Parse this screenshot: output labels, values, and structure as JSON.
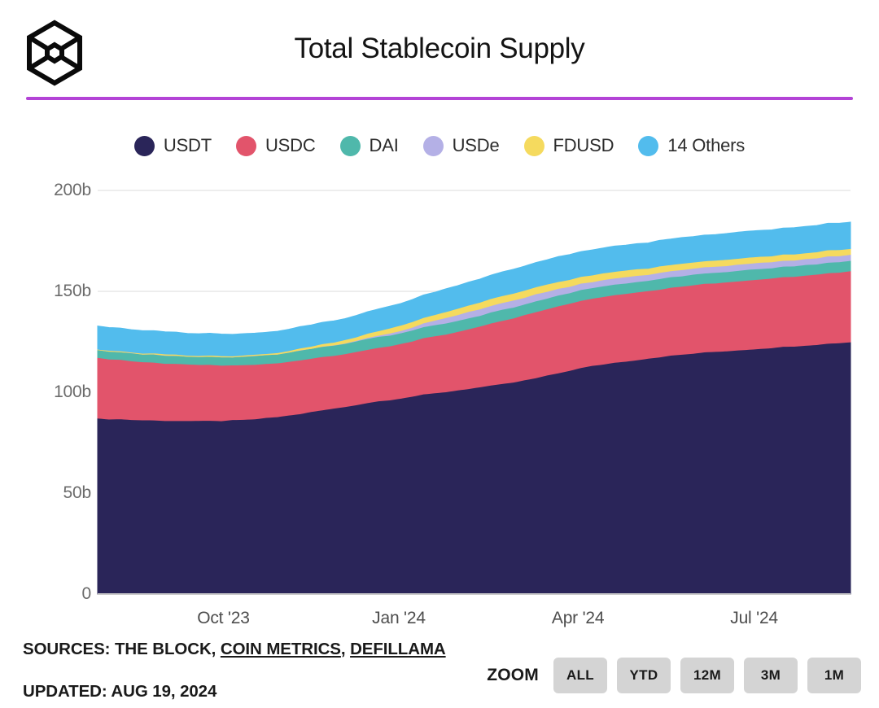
{
  "header": {
    "title": "Total Stablecoin Supply",
    "logo_icon": "the-block-hexagon-logo",
    "accent_color": "#b343d6"
  },
  "footer": {
    "sources_prefix": "SOURCES: THE BLOCK, ",
    "source_link_1": "COIN METRICS",
    "sources_comma": ",",
    "source_link_2": "DEFILLAMA",
    "updated": "UPDATED: AUG 19, 2024",
    "zoom_label": "ZOOM",
    "zoom_options": [
      "ALL",
      "YTD",
      "12M",
      "3M",
      "1M"
    ]
  },
  "chart_data": {
    "type": "area",
    "stacked": true,
    "title": "Total Stablecoin Supply",
    "xlabel": "",
    "ylabel": "",
    "grid": true,
    "grid_lines_at": [
      150,
      200
    ],
    "legend_position": "top-center",
    "ylim": [
      0,
      200
    ],
    "y_ticks": [
      0,
      50,
      100,
      150,
      200
    ],
    "y_tick_labels": [
      "0",
      "50b",
      "100b",
      "150b",
      "200b"
    ],
    "y_unit": "billions USD",
    "x_ticks": [
      "Oct '23",
      "Jan '24",
      "Apr '24",
      "Jul '24"
    ],
    "x_tick_positions": [
      0.167,
      0.4,
      0.638,
      0.872
    ],
    "x_range": [
      "Aug '23",
      "Aug 19 2024"
    ],
    "colors": {
      "USDT": "#2a2559",
      "USDC": "#e2546b",
      "DAI": "#4fb8ab",
      "USDe": "#b4b0e6",
      "FDUSD": "#f5da5e",
      "14 Others": "#52bced"
    },
    "series": [
      {
        "name": "USDT",
        "color": "#2a2559",
        "values": [
          87.0,
          86.9,
          86.8,
          86.5,
          86.3,
          86.2,
          86.1,
          86.0,
          85.9,
          85.8,
          85.9,
          86.0,
          86.2,
          86.4,
          86.8,
          87.3,
          87.9,
          88.6,
          89.4,
          90.3,
          91.2,
          92.0,
          92.9,
          93.9,
          94.9,
          95.7,
          96.4,
          97.2,
          98.0,
          98.9,
          99.6,
          100.3,
          101.1,
          101.9,
          102.6,
          103.3,
          104.1,
          105.0,
          106.0,
          107.1,
          108.3,
          109.6,
          110.9,
          112.1,
          113.1,
          114.0,
          114.8,
          115.5,
          116.2,
          116.9,
          117.6,
          118.2,
          118.8,
          119.3,
          119.8,
          120.2,
          120.6,
          121.0,
          121.4,
          121.8,
          122.2,
          122.6,
          123.0,
          123.4,
          123.8,
          124.2,
          124.6,
          125.0
        ]
      },
      {
        "name": "USDC",
        "color": "#e2546b",
        "values": [
          30.0,
          29.7,
          29.4,
          29.1,
          28.8,
          28.6,
          28.4,
          28.2,
          28.0,
          27.8,
          27.6,
          27.4,
          27.2,
          27.0,
          26.9,
          26.8,
          26.7,
          26.6,
          26.5,
          26.4,
          26.3,
          26.2,
          26.2,
          26.3,
          26.4,
          26.6,
          26.8,
          27.1,
          27.4,
          27.8,
          28.2,
          28.6,
          29.0,
          29.5,
          30.0,
          30.6,
          31.2,
          31.8,
          32.2,
          32.6,
          32.9,
          33.1,
          33.2,
          33.3,
          33.4,
          33.5,
          33.6,
          33.6,
          33.6,
          33.6,
          33.6,
          33.6,
          33.7,
          33.8,
          33.9,
          34.0,
          34.1,
          34.2,
          34.3,
          34.4,
          34.5,
          34.6,
          34.7,
          34.8,
          34.9,
          35.0,
          35.1,
          35.2
        ]
      },
      {
        "name": "DAI",
        "color": "#4fb8ab",
        "values": [
          3.9,
          3.9,
          3.9,
          3.9,
          3.9,
          3.9,
          3.9,
          3.9,
          4.0,
          4.0,
          4.0,
          4.1,
          4.2,
          4.3,
          4.4,
          4.5,
          4.6,
          4.7,
          4.8,
          4.9,
          5.0,
          5.1,
          5.2,
          5.3,
          5.3,
          5.4,
          5.4,
          5.4,
          5.4,
          5.4,
          5.4,
          5.4,
          5.4,
          5.4,
          5.4,
          5.4,
          5.4,
          5.3,
          5.3,
          5.3,
          5.3,
          5.3,
          5.3,
          5.3,
          5.3,
          5.3,
          5.3,
          5.2,
          5.2,
          5.2,
          5.2,
          5.2,
          5.2,
          5.2,
          5.2,
          5.2,
          5.2,
          5.2,
          5.2,
          5.2,
          5.2,
          5.2,
          5.2,
          5.2,
          5.2,
          5.2,
          5.2,
          5.2
        ]
      },
      {
        "name": "USDe",
        "color": "#b4b0e6",
        "values": [
          0.0,
          0.0,
          0.0,
          0.0,
          0.0,
          0.0,
          0.0,
          0.0,
          0.0,
          0.0,
          0.0,
          0.0,
          0.0,
          0.0,
          0.0,
          0.0,
          0.0,
          0.0,
          0.0,
          0.0,
          0.1,
          0.2,
          0.3,
          0.4,
          0.5,
          0.7,
          0.9,
          1.2,
          1.5,
          1.9,
          2.3,
          2.6,
          2.9,
          3.1,
          3.2,
          3.3,
          3.3,
          3.4,
          3.4,
          3.4,
          3.3,
          3.3,
          3.2,
          3.2,
          3.1,
          3.1,
          3.0,
          3.0,
          3.0,
          3.0,
          3.0,
          3.0,
          3.0,
          3.0,
          3.0,
          3.0,
          3.0,
          3.0,
          3.0,
          3.0,
          3.0,
          3.0,
          3.0,
          3.0,
          3.0,
          3.0,
          3.0,
          3.0
        ]
      },
      {
        "name": "FDUSD",
        "color": "#f5da5e",
        "values": [
          0.4,
          0.4,
          0.4,
          0.4,
          0.4,
          0.5,
          0.5,
          0.5,
          0.5,
          0.5,
          0.5,
          0.5,
          0.6,
          0.6,
          0.6,
          0.6,
          0.7,
          0.8,
          0.9,
          1.0,
          1.2,
          1.4,
          1.6,
          1.8,
          2.0,
          2.2,
          2.4,
          2.6,
          2.7,
          2.8,
          2.9,
          3.0,
          3.1,
          3.2,
          3.3,
          3.4,
          3.4,
          3.5,
          3.5,
          3.5,
          3.5,
          3.4,
          3.4,
          3.4,
          3.3,
          3.3,
          3.3,
          3.2,
          3.2,
          3.2,
          3.1,
          3.1,
          3.1,
          3.1,
          3.0,
          3.0,
          3.0,
          3.0,
          3.0,
          3.0,
          3.0,
          3.0,
          3.0,
          3.0,
          3.0,
          3.0,
          3.0,
          3.0
        ]
      },
      {
        "name": "14 Others",
        "color": "#52bced",
        "values": [
          11.5,
          11.4,
          11.3,
          11.2,
          11.1,
          11.0,
          11.0,
          10.9,
          10.9,
          10.8,
          10.8,
          10.7,
          10.7,
          10.6,
          10.6,
          10.6,
          10.5,
          10.5,
          10.5,
          10.5,
          10.5,
          10.5,
          10.5,
          10.6,
          10.6,
          10.7,
          10.8,
          10.9,
          11.0,
          11.1,
          11.2,
          11.3,
          11.4,
          11.5,
          11.6,
          11.7,
          11.8,
          11.9,
          12.0,
          12.1,
          12.2,
          12.3,
          12.3,
          12.4,
          12.4,
          12.5,
          12.5,
          12.5,
          12.6,
          12.6,
          12.6,
          12.7,
          12.7,
          12.7,
          12.8,
          12.8,
          12.8,
          12.9,
          12.9,
          12.9,
          13.0,
          13.0,
          13.0,
          13.1,
          13.1,
          13.1,
          13.2,
          13.2
        ]
      }
    ]
  }
}
